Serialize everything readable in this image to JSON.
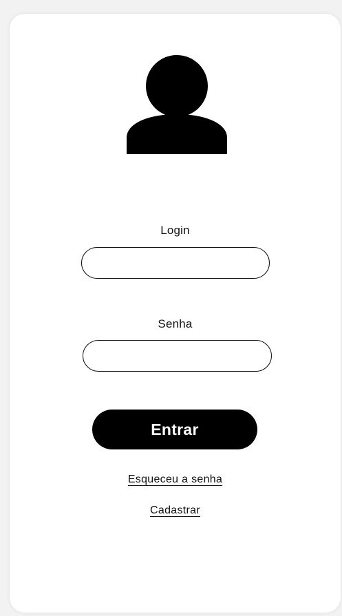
{
  "login_form": {
    "login_label": "Login",
    "login_value": "",
    "password_label": "Senha",
    "password_value": "",
    "submit_label": "Entrar",
    "forgot_password_link": "Esqueceu a senha",
    "register_link": "Cadastrar"
  },
  "icons": {
    "avatar": "user-silhouette-icon"
  },
  "colors": {
    "background": "#f2f2f2",
    "card": "#ffffff",
    "button": "#000000",
    "button_text": "#ffffff",
    "text": "#111111"
  }
}
